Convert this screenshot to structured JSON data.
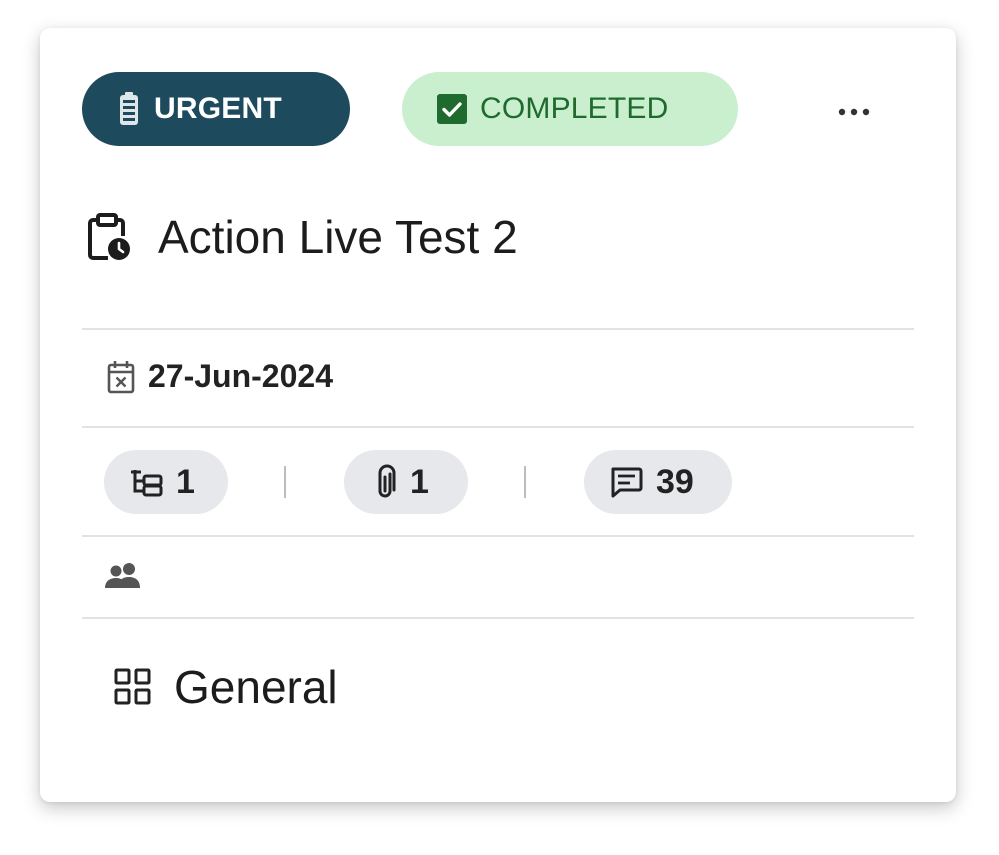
{
  "card": {
    "priority_badge": {
      "label": "URGENT",
      "color": "#1e4a5e",
      "icon": "battery-icon"
    },
    "status_badge": {
      "label": "COMPLETED",
      "color": "#c9efcf",
      "icon": "checkbox-checked-icon"
    },
    "more_menu": {
      "icon": "more-horizontal-icon"
    },
    "title": {
      "text": "Action Live Test 2",
      "icon": "clipboard-clock-icon"
    },
    "due_date": {
      "text": "27-Jun-2024",
      "icon": "calendar-x-icon"
    },
    "stats": {
      "subtasks": {
        "count": "1",
        "icon": "subtask-tree-icon"
      },
      "attachments": {
        "count": "1",
        "icon": "paperclip-icon"
      },
      "comments": {
        "count": "39",
        "icon": "comment-icon"
      }
    },
    "assignees": {
      "icon": "people-icon"
    },
    "category": {
      "text": "General",
      "icon": "grid-icon"
    }
  }
}
